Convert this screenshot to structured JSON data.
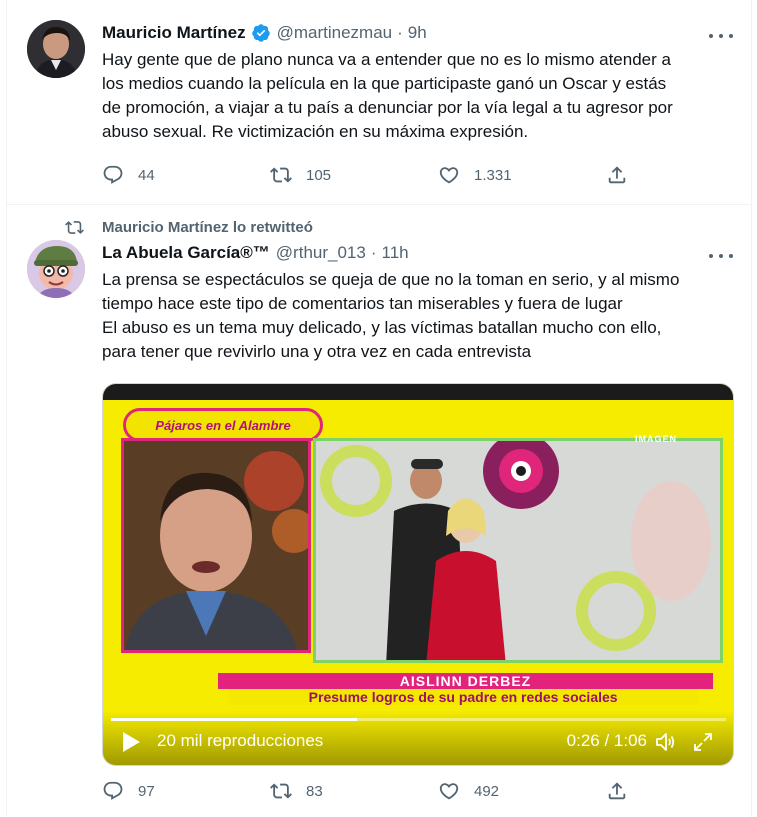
{
  "tweet1": {
    "author_name": "Mauricio Martínez",
    "handle": "@martinezmau",
    "separator": "·",
    "time": "9h",
    "text_lines": [
      "Hay gente que de plano nunca va a entender que no es lo mismo atender a",
      "los medios cuando la película en la que participaste ganó un Oscar y estás",
      "de promoción, a viajar a tu país a denunciar por la vía legal a tu agresor por",
      "abuso sexual. Re victimización en su máxima expresión."
    ],
    "replies": "44",
    "retweets": "105",
    "likes": "1.331"
  },
  "tweet2": {
    "retweet_notice": "Mauricio Martínez lo retwitteó",
    "author_name": "La Abuela García®™",
    "handle": "@rthur_013",
    "separator": "·",
    "time": "11h",
    "text_lines": [
      "La prensa se espectáculos se queja de que no la toman en serio, y al mismo",
      "tiempo hace este tipo de comentarios tan miserables y fuera de lugar",
      "El abuso es un tema muy delicado, y las víctimas batallan mucho con ello,",
      "para tener que revivirlo una y otra vez en cada entrevista"
    ],
    "video": {
      "show_title": "Pájaros en el Alambre",
      "channel": "IMAGEN",
      "lower_third_name": "AISLINN DERBEZ",
      "lower_third_caption": "Presume logros de su padre en redes sociales",
      "views": "20 mil reproducciones",
      "duration": "0:26 / 1:06",
      "progress": 0.4
    },
    "replies": "97",
    "retweets": "83",
    "likes": "492"
  },
  "colors": {
    "verified_blue": "#1d9bf0",
    "secondary_text": "#536471",
    "primary_text": "#0f1419",
    "video_yellow": "#f6ec00",
    "video_magenta": "#e3227d"
  },
  "icons": [
    "verified-badge-icon",
    "more-icon",
    "reply-icon",
    "retweet-icon",
    "like-icon",
    "share-icon",
    "play-icon",
    "volume-icon",
    "fullscreen-icon"
  ]
}
